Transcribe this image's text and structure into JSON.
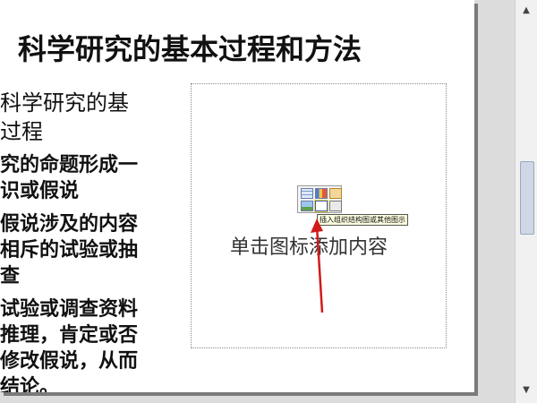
{
  "slide": {
    "title": "科学研究的基本过程和方法",
    "left_text": [
      " 科学研究的基",
      "过程",
      "究的命题形成一",
      "识或假说",
      "假说涉及的内容",
      "相斥的试验或抽",
      "查",
      "试验或调查资料",
      "推理，肯定或否",
      "修改假说，从而",
      "结论。"
    ],
    "placeholder": {
      "text": "单击图标添加内容",
      "tooltip": "插入组织结构图或其他图示"
    },
    "icons": [
      "table-icon",
      "chart-icon",
      "clip-art-icon",
      "picture-icon",
      "org-chart-icon",
      "media-icon"
    ],
    "arrow_color": "#d11a1a"
  }
}
